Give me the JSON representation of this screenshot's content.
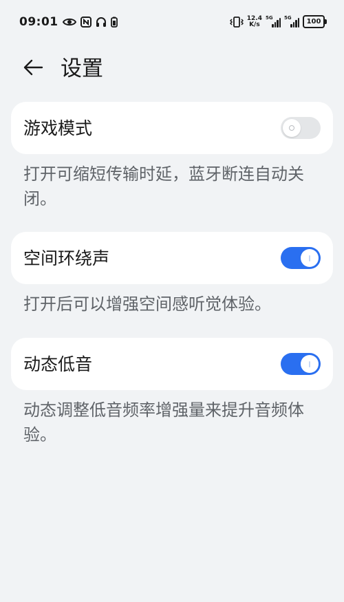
{
  "status_bar": {
    "time": "09:01",
    "speed_value": "12.4",
    "speed_unit": "K/s",
    "sim1_tag": "5G",
    "sim2_tag": "5G",
    "battery": "100"
  },
  "header": {
    "title": "设置",
    "back_icon": "arrow-left-icon"
  },
  "settings": [
    {
      "label": "游戏模式",
      "enabled": false,
      "description": "打开可缩短传输时延，蓝牙断连自动关闭。"
    },
    {
      "label": "空间环绕声",
      "enabled": true,
      "description": "打开后可以增强空间感听觉体验。"
    },
    {
      "label": "动态低音",
      "enabled": true,
      "description": "动态调整低音频率增强量来提升音频体验。"
    }
  ],
  "colors": {
    "background": "#f1f3f5",
    "card": "#ffffff",
    "accent": "#2a6ff0",
    "toggle_off": "#e4e6e8",
    "description_text": "#5f6368"
  }
}
